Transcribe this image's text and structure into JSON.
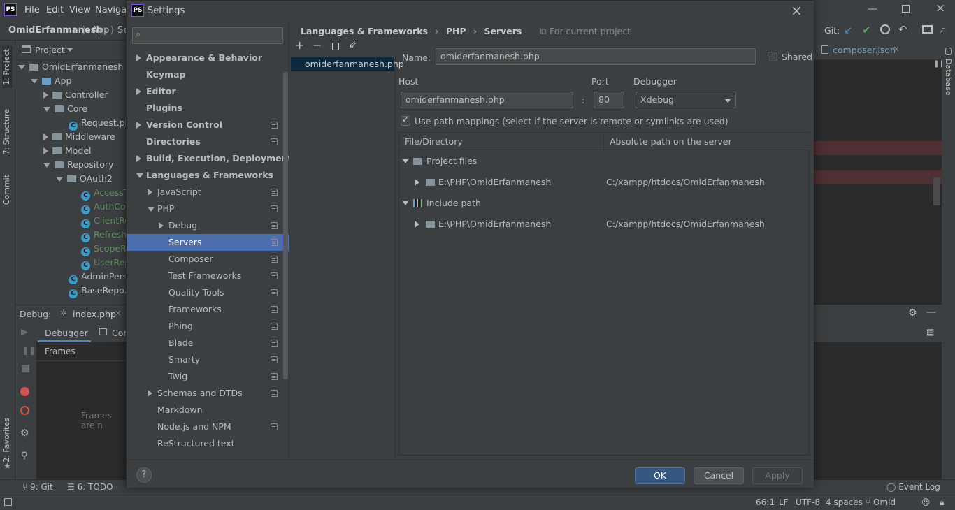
{
  "ide": {
    "logo": "PS",
    "menu": [
      "File",
      "Edit",
      "View",
      "Navigate"
    ],
    "nav": {
      "project": "OmidErfanmanesh",
      "sep": "⟩",
      "folder": "App",
      "folder2": "Se"
    },
    "left_tabs": {
      "project": "1: Project",
      "structure": "7: Structure",
      "commit": "Commit",
      "favorites": "2: Favorites"
    },
    "project_header": "Project",
    "tree": [
      {
        "label": "OmidErfanmanesh [Pe",
        "kind": "folder",
        "expanded": true
      },
      {
        "label": "App",
        "kind": "folder",
        "expanded": true
      },
      {
        "label": "Controller",
        "kind": "folder",
        "expanded": false
      },
      {
        "label": "Core",
        "kind": "folder",
        "expanded": true
      },
      {
        "label": "Request.php",
        "kind": "class"
      },
      {
        "label": "Middleware",
        "kind": "folder",
        "expanded": false
      },
      {
        "label": "Model",
        "kind": "folder",
        "expanded": false
      },
      {
        "label": "Repository",
        "kind": "folder",
        "expanded": true
      },
      {
        "label": "OAuth2",
        "kind": "folder",
        "expanded": true
      },
      {
        "label": "AccessTo",
        "kind": "class"
      },
      {
        "label": "AuthCod",
        "kind": "class"
      },
      {
        "label": "ClientRep",
        "kind": "class"
      },
      {
        "label": "RefreshT",
        "kind": "class"
      },
      {
        "label": "ScopeRe",
        "kind": "class"
      },
      {
        "label": "UserRepo",
        "kind": "class"
      },
      {
        "label": "AdminPerso",
        "kind": "class"
      },
      {
        "label": "BaseRepo.pl",
        "kind": "class"
      }
    ],
    "debug": {
      "label": "Debug:",
      "tab": "index.php",
      "debugger_tab": "Debugger",
      "console_tab": "Con",
      "frames": "Frames",
      "frames_empty": "Frames are n"
    },
    "bottom": {
      "git": "9: Git",
      "todo": "6: TODO",
      "event_log": "Event Log"
    },
    "status": {
      "position": "66:1",
      "line_sep": "LF",
      "encoding": "UTF-8",
      "indent": "4 spaces",
      "branch": "Omid"
    },
    "right": {
      "git_label": "Git:",
      "editor_tab": "composer.json",
      "database_tab": "Database"
    }
  },
  "dialog": {
    "logo": "PS",
    "title": "Settings",
    "search": {
      "placeholder": ""
    },
    "nav": [
      {
        "label": "Appearance & Behavior",
        "bold": true,
        "arrow": "right",
        "indent": 0,
        "copy": false
      },
      {
        "label": "Keymap",
        "bold": true,
        "arrow": "",
        "indent": 0,
        "copy": false
      },
      {
        "label": "Editor",
        "bold": true,
        "arrow": "right",
        "indent": 0,
        "copy": false
      },
      {
        "label": "Plugins",
        "bold": true,
        "arrow": "",
        "indent": 0,
        "copy": false
      },
      {
        "label": "Version Control",
        "bold": true,
        "arrow": "right",
        "indent": 0,
        "copy": true
      },
      {
        "label": "Directories",
        "bold": true,
        "arrow": "",
        "indent": 0,
        "copy": true
      },
      {
        "label": "Build, Execution, Deployment",
        "bold": true,
        "arrow": "right",
        "indent": 0,
        "copy": false
      },
      {
        "label": "Languages & Frameworks",
        "bold": true,
        "arrow": "down",
        "indent": 0,
        "copy": false
      },
      {
        "label": "JavaScript",
        "bold": false,
        "arrow": "right",
        "indent": 1,
        "copy": true
      },
      {
        "label": "PHP",
        "bold": false,
        "arrow": "down",
        "indent": 1,
        "copy": true
      },
      {
        "label": "Debug",
        "bold": false,
        "arrow": "right",
        "indent": 2,
        "copy": true
      },
      {
        "label": "Servers",
        "bold": false,
        "arrow": "",
        "indent": 2,
        "copy": true,
        "selected": true
      },
      {
        "label": "Composer",
        "bold": false,
        "arrow": "",
        "indent": 2,
        "copy": true
      },
      {
        "label": "Test Frameworks",
        "bold": false,
        "arrow": "",
        "indent": 2,
        "copy": true
      },
      {
        "label": "Quality Tools",
        "bold": false,
        "arrow": "",
        "indent": 2,
        "copy": true
      },
      {
        "label": "Frameworks",
        "bold": false,
        "arrow": "",
        "indent": 2,
        "copy": true
      },
      {
        "label": "Phing",
        "bold": false,
        "arrow": "",
        "indent": 2,
        "copy": true
      },
      {
        "label": "Blade",
        "bold": false,
        "arrow": "",
        "indent": 2,
        "copy": true
      },
      {
        "label": "Smarty",
        "bold": false,
        "arrow": "",
        "indent": 2,
        "copy": true
      },
      {
        "label": "Twig",
        "bold": false,
        "arrow": "",
        "indent": 2,
        "copy": true
      },
      {
        "label": "Schemas and DTDs",
        "bold": false,
        "arrow": "right",
        "indent": 1,
        "copy": true
      },
      {
        "label": "Markdown",
        "bold": false,
        "arrow": "",
        "indent": 1,
        "copy": false
      },
      {
        "label": "Node.js and NPM",
        "bold": false,
        "arrow": "",
        "indent": 1,
        "copy": true
      },
      {
        "label": "ReStructured text",
        "bold": false,
        "arrow": "",
        "indent": 1,
        "copy": false
      }
    ],
    "breadcrumb": {
      "part1": "Languages & Frameworks",
      "part2": "PHP",
      "part3": "Servers",
      "scope": "For current project"
    },
    "servers": [
      "omiderfanmanesh.php"
    ],
    "form": {
      "name_label": "Name:",
      "name_value": "omiderfanmanesh.php",
      "shared_label": "Shared",
      "shared_checked": false,
      "host_label": "Host",
      "host_value": "omiderfanmanesh.php",
      "colon": ":",
      "port_label": "Port",
      "port_value": "80",
      "debugger_label": "Debugger",
      "debugger_value": "Xdebug",
      "path_map_label": "Use path mappings (select if the server is remote or symlinks are used)",
      "path_map_checked": true
    },
    "mapping": {
      "col1": "File/Directory",
      "col2": "Absolute path on the server",
      "rows": [
        {
          "type": "group",
          "label": "Project files",
          "icon": "folder"
        },
        {
          "type": "entry",
          "local": "E:\\PHP\\OmidErfanmanesh",
          "server": "C:/xampp/htdocs/OmidErfanmanesh"
        },
        {
          "type": "group",
          "label": "Include path",
          "icon": "library"
        },
        {
          "type": "entry",
          "local": "E:\\PHP\\OmidErfanmanesh",
          "server": "C:/xampp/htdocs/OmidErfanmanesh"
        }
      ]
    },
    "buttons": {
      "help": "?",
      "ok": "OK",
      "cancel": "Cancel",
      "apply": "Apply"
    }
  }
}
